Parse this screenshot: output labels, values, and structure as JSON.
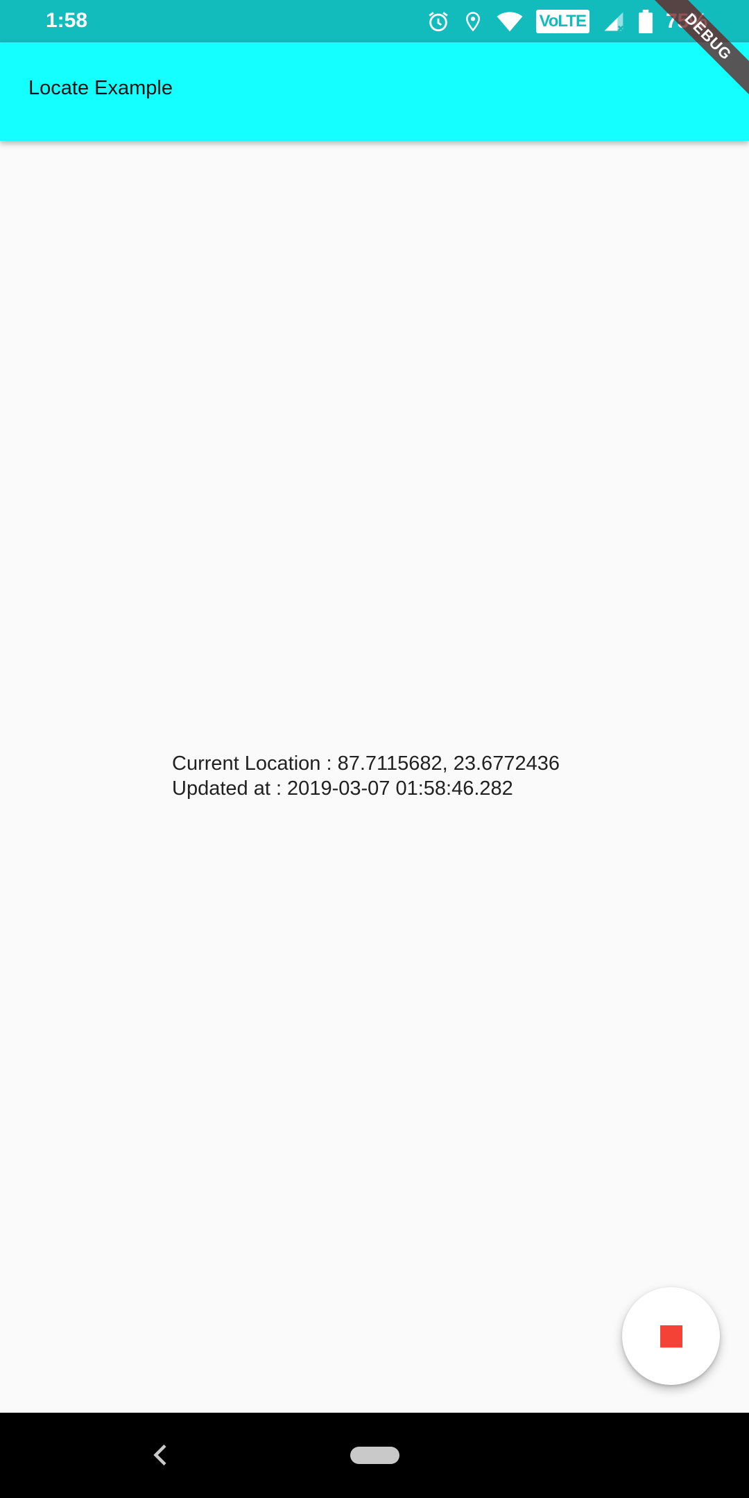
{
  "status_bar": {
    "time": "1:58",
    "volte": "VoLTE",
    "battery_percent": "75%",
    "icons": [
      "alarm-icon",
      "location-icon",
      "wifi-icon",
      "volte-icon",
      "signal-icon",
      "battery-icon"
    ]
  },
  "app_bar": {
    "title": "Locate Example"
  },
  "debug_banner": {
    "label": "DEBUG"
  },
  "content": {
    "current_location": "Current Location : 87.7115682, 23.6772436",
    "updated_at": "Updated at : 2019-03-07 01:58:46.282"
  },
  "fab": {
    "icon": "stop-icon"
  },
  "nav_bar": {
    "icons": [
      "back-icon",
      "home-pill-icon"
    ]
  },
  "colors": {
    "status_bar": "#13bcbc",
    "app_bar": "#14ffff",
    "background": "#fafafa",
    "stop_icon": "#f44336",
    "nav_bar": "#000000"
  }
}
